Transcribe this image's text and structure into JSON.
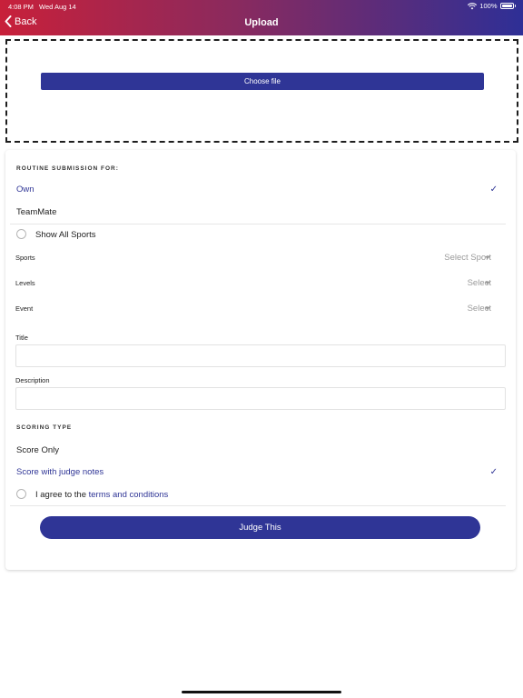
{
  "status_bar": {
    "time": "4:08 PM",
    "date": "Wed Aug 14",
    "battery": "100%"
  },
  "nav": {
    "back_label": "Back",
    "title": "Upload"
  },
  "upload": {
    "choose_file_label": "Choose file"
  },
  "routine": {
    "header": "ROUTINE SUBMISSION FOR:",
    "options": [
      {
        "label": "Own",
        "selected": true
      },
      {
        "label": "TeamMate",
        "selected": false
      }
    ]
  },
  "show_all_sports": {
    "label": "Show All Sports"
  },
  "fields": {
    "sports": {
      "label": "Sports",
      "value": "Select Sport"
    },
    "levels": {
      "label": "Levels",
      "value": "Select"
    },
    "event": {
      "label": "Event",
      "value": "Select"
    },
    "title": {
      "label": "Title",
      "value": ""
    },
    "description": {
      "label": "Description",
      "value": ""
    }
  },
  "scoring": {
    "header": "SCORING TYPE",
    "options": [
      {
        "label": "Score Only",
        "selected": false
      },
      {
        "label": "Score with judge notes",
        "selected": true
      }
    ]
  },
  "agree": {
    "prefix": "I agree to the ",
    "link": "terms and conditions"
  },
  "submit": {
    "label": "Judge This"
  },
  "colors": {
    "accent": "#2f3596",
    "header_start": "#c8203a",
    "header_end": "#2e2f96"
  }
}
